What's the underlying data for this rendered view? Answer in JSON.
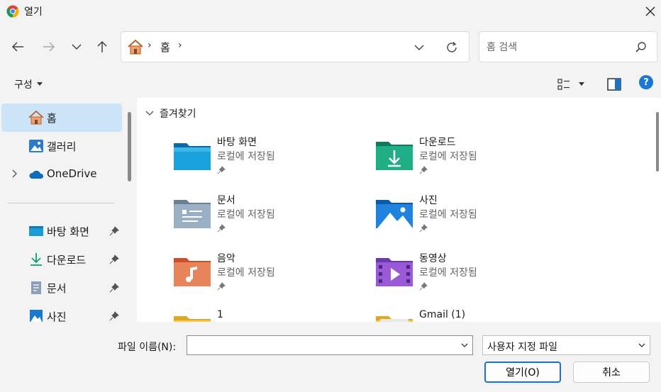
{
  "window": {
    "title": "열기"
  },
  "address": {
    "crumb": "홈",
    "separator": "›"
  },
  "search": {
    "placeholder": "홈 검색"
  },
  "toolbar": {
    "organize_label": "구성"
  },
  "sidebar": {
    "items": [
      {
        "label": "홈",
        "icon": "home-icon",
        "selected": true
      },
      {
        "label": "갤러리",
        "icon": "gallery-icon"
      },
      {
        "label": "OneDrive",
        "icon": "onedrive-icon"
      },
      {
        "label": "바탕 화면",
        "icon": "desktop-icon",
        "pinned": true
      },
      {
        "label": "다운로드",
        "icon": "download-icon",
        "pinned": true
      },
      {
        "label": "문서",
        "icon": "documents-icon",
        "pinned": true
      },
      {
        "label": "사진",
        "icon": "pictures-icon",
        "pinned": true
      }
    ]
  },
  "main": {
    "group_label": "즐겨찾기",
    "tiles": [
      {
        "name": "바탕 화면",
        "sub": "로컬에 저장됨",
        "icon": "desktop-folder-icon"
      },
      {
        "name": "다운로드",
        "sub": "로컬에 저장됨",
        "icon": "downloads-folder-icon"
      },
      {
        "name": "문서",
        "sub": "로컬에 저장됨",
        "icon": "documents-folder-icon"
      },
      {
        "name": "사진",
        "sub": "로컬에 저장됨",
        "icon": "pictures-folder-icon"
      },
      {
        "name": "음악",
        "sub": "로컬에 저장됨",
        "icon": "music-folder-icon"
      },
      {
        "name": "동영상",
        "sub": "로컬에 저장됨",
        "icon": "videos-folder-icon"
      },
      {
        "name": "1",
        "sub": "",
        "icon": "folder-icon"
      },
      {
        "name": "Gmail (1)",
        "sub": "",
        "icon": "folder-icon"
      }
    ]
  },
  "bottom": {
    "filename_label": "파일 이름(N):",
    "filename_value": "",
    "filter_value": "사용자 지정 파일",
    "open_label": "열기(O)",
    "cancel_label": "취소"
  },
  "colors": {
    "accent": "#1a73c8",
    "selection": "#cce4f7"
  }
}
